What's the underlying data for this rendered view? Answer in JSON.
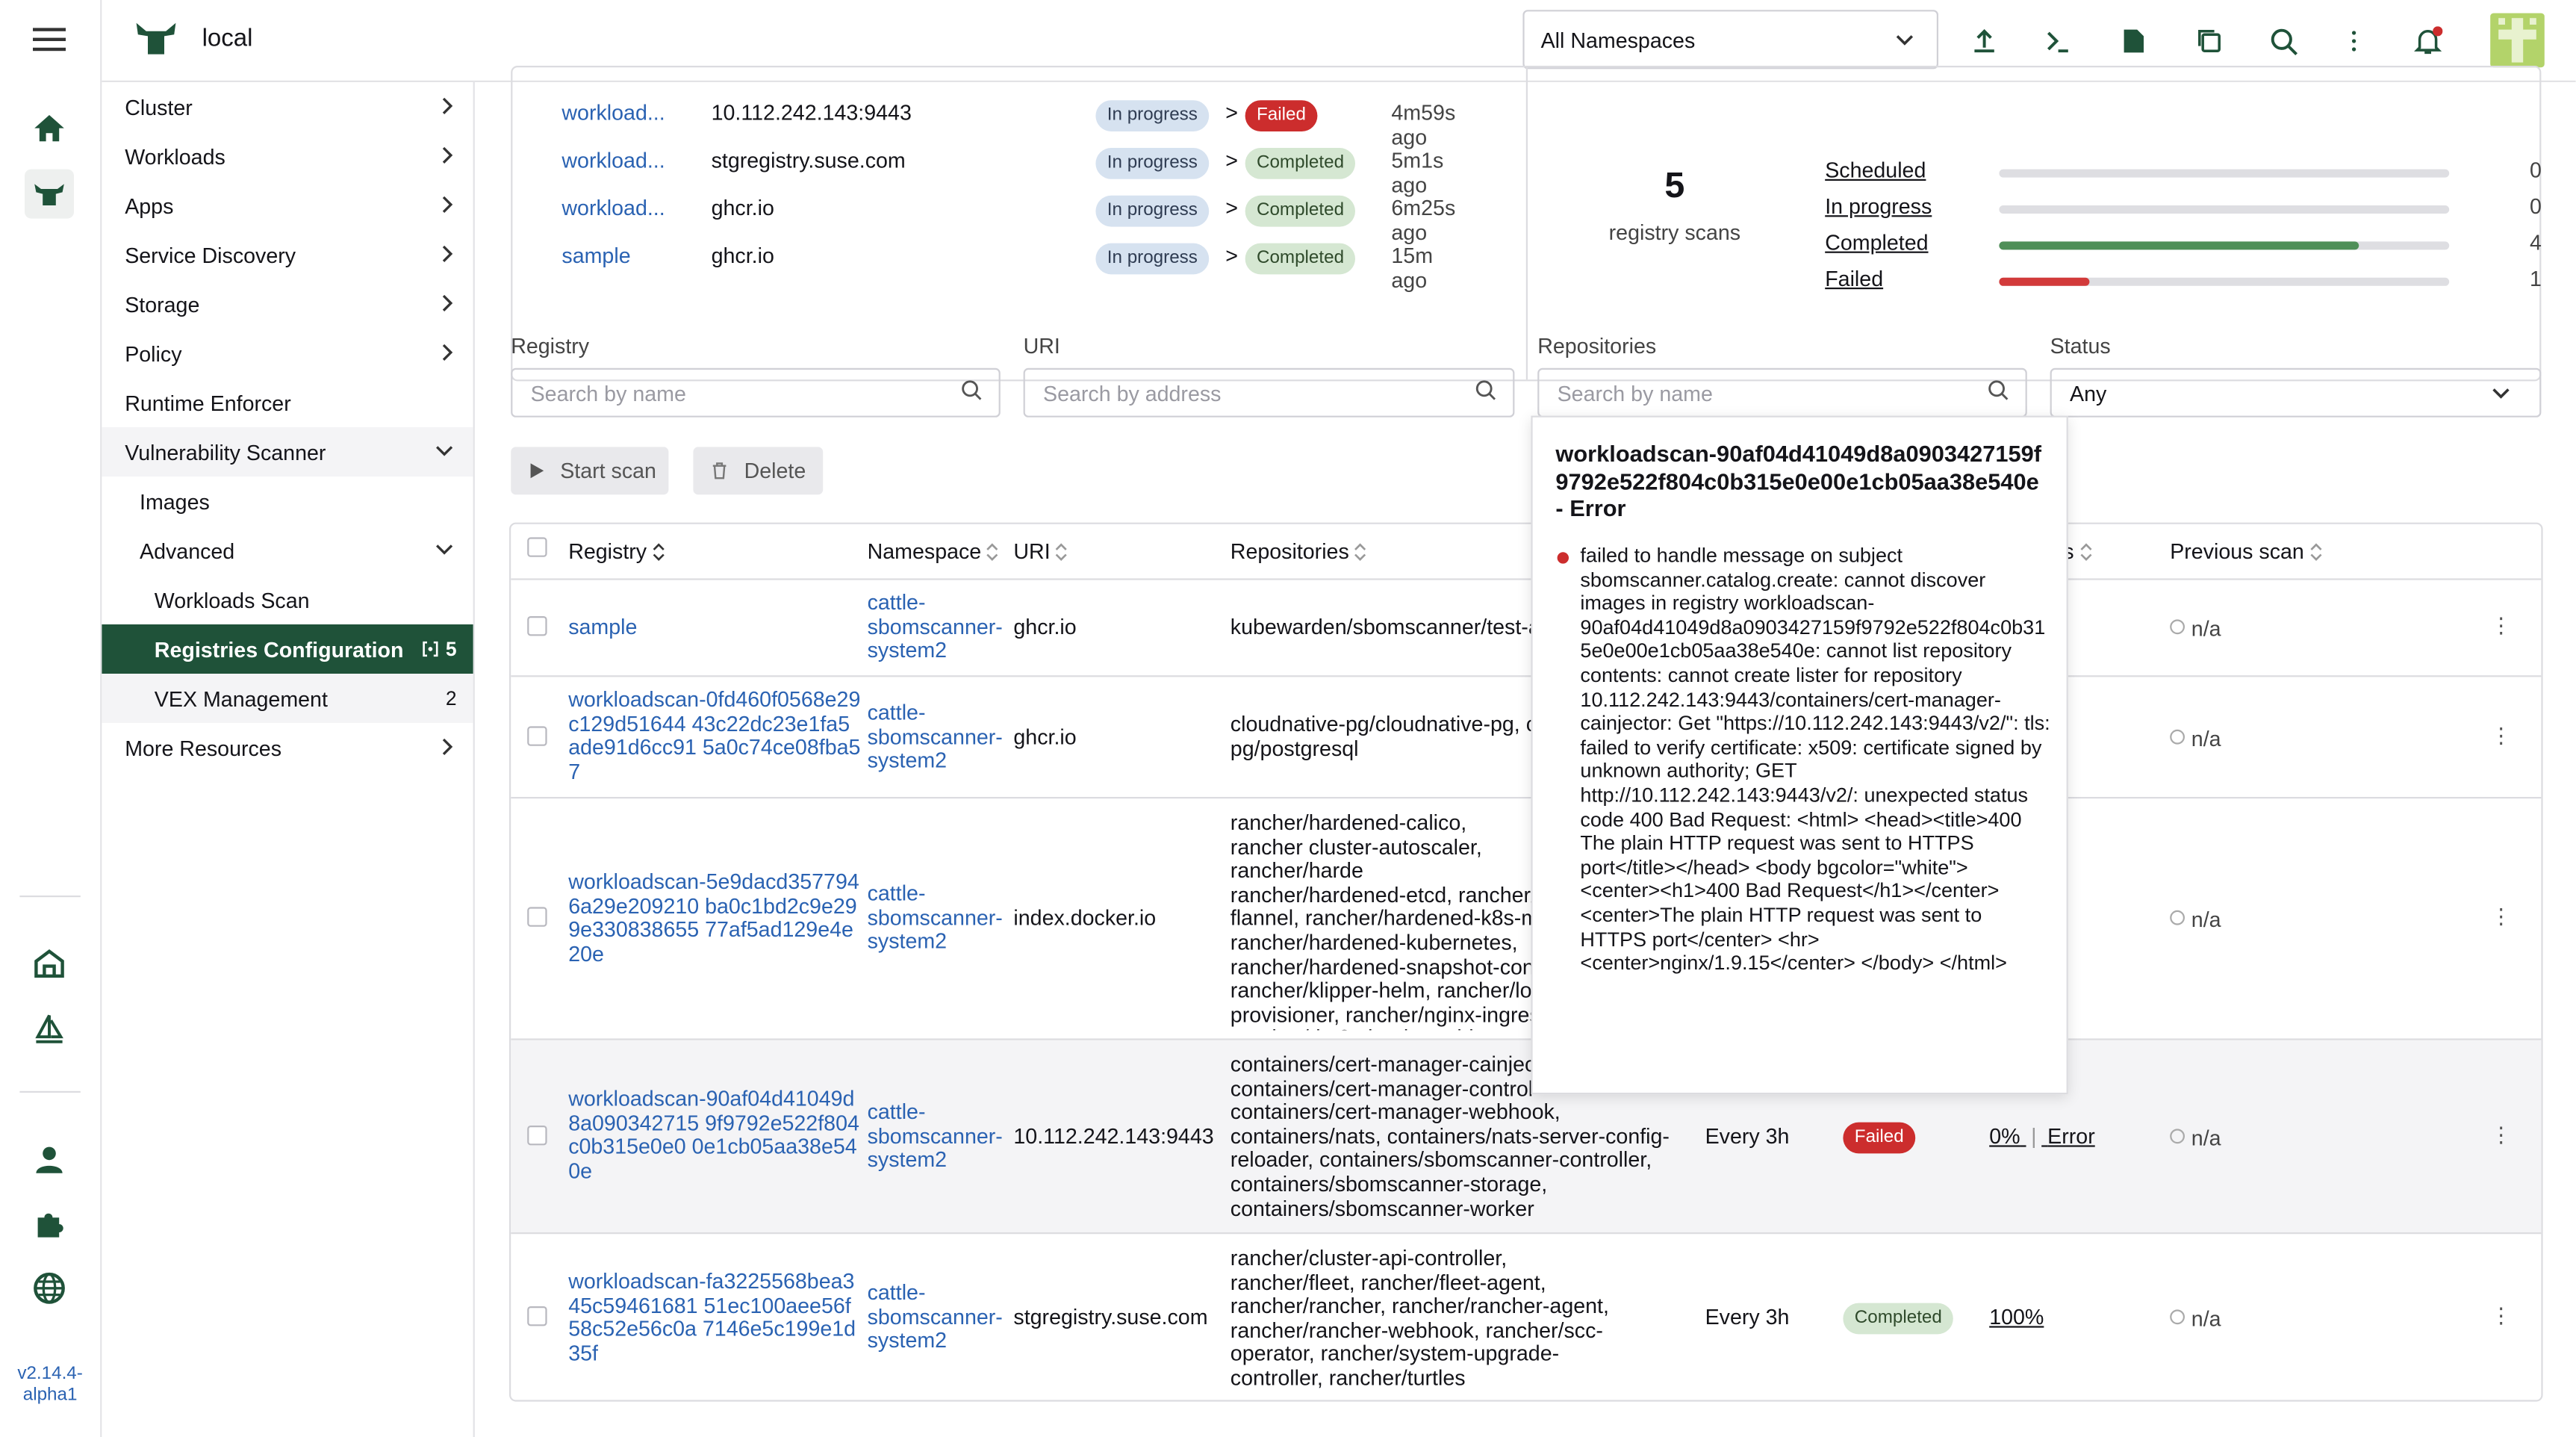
{
  "header": {
    "cluster_name": "local",
    "namespace_select": "All Namespaces"
  },
  "rail": {
    "version": "v2.14.4-alpha1"
  },
  "nav": {
    "items": [
      {
        "label": "Cluster"
      },
      {
        "label": "Workloads"
      },
      {
        "label": "Apps"
      },
      {
        "label": "Service Discovery"
      },
      {
        "label": "Storage"
      },
      {
        "label": "Policy"
      },
      {
        "label": "Runtime Enforcer"
      },
      {
        "label": "Vulnerability Scanner"
      },
      {
        "label": "Images"
      },
      {
        "label": "Advanced"
      },
      {
        "label": "Workloads Scan"
      },
      {
        "label": "Registries Configuration",
        "count": "5"
      },
      {
        "label": "VEX Management",
        "count": "2"
      },
      {
        "label": "More Resources"
      }
    ]
  },
  "recent_scans": [
    {
      "name": "workload...",
      "registry": "10.112.242.143:9443",
      "from": "In progress",
      "to": "Failed",
      "ago": "4m59s ago"
    },
    {
      "name": "workload...",
      "registry": "stgregistry.suse.com",
      "from": "In progress",
      "to": "Completed",
      "ago": "5m1s ago"
    },
    {
      "name": "workload...",
      "registry": "ghcr.io",
      "from": "In progress",
      "to": "Completed",
      "ago": "6m25s ago"
    },
    {
      "name": "sample",
      "registry": "ghcr.io",
      "from": "In progress",
      "to": "Completed",
      "ago": "15m ago"
    }
  ],
  "arrow": ">",
  "summary": {
    "total": "5",
    "total_label": "registry scans",
    "stats": [
      {
        "label": "Scheduled",
        "value": 0,
        "color": "#dedee2"
      },
      {
        "label": "In progress",
        "value": 0,
        "color": "#dedee2"
      },
      {
        "label": "Completed",
        "value": 4,
        "color": "#4f8f58"
      },
      {
        "label": "Failed",
        "value": 1,
        "color": "#d23a3a"
      }
    ],
    "fill_fractions": [
      0,
      0,
      0.8,
      0.2
    ]
  },
  "filters": {
    "registry_label": "Registry",
    "registry_placeholder": "Search by name",
    "uri_label": "URI",
    "uri_placeholder": "Search by address",
    "repos_label": "Repositories",
    "repos_placeholder": "Search by name",
    "status_label": "Status",
    "status_value": "Any"
  },
  "actions": {
    "start_scan": "Start scan",
    "delete": "Delete"
  },
  "table": {
    "headers": {
      "registry": "Registry",
      "namespace": "Namespace",
      "uri": "URI",
      "repositories": "Repositories",
      "hidden_tail": "s",
      "previous_scan": "Previous scan"
    },
    "rows": [
      {
        "registry": "sample",
        "namespace": "cattle-sbomscanner-system2",
        "uri": "ghcr.io",
        "repositories": "kubewarden/sbomscanner/test-a",
        "previous": "n/a"
      },
      {
        "registry": "workloadscan-0fd460f0568e29c129d51644 43c22dc23e1fa5ade91d6cc91 5a0c74ce08fba57",
        "namespace": "cattle-sbomscanner-system2",
        "uri": "ghcr.io",
        "repositories": "cloudnative-pg/cloudnative-pg, c pg/postgresql",
        "previous": "n/a"
      },
      {
        "registry": "workloadscan-5e9dacd3577946a29e209210 ba0c1bd2c9e299e330838655 77af5ad129e4e20e",
        "namespace": "cattle-sbomscanner-system2",
        "uri": "index.docker.io",
        "repositories": "rancher/hardened-calico, rancher cluster-autoscaler, rancher/harde rancher/hardened-etcd, rancher/ flannel, rancher/hardened-k8s-m rancher/hardened-kubernetes, rancher/hardened-snapshot-cont rancher/klipper-helm, rancher/lo provisioner, rancher/nginx-ingres rancher/rke2-cloud-provider",
        "previous": "n/a"
      },
      {
        "registry": "workloadscan-90af04d41049d8a090342715 9f9792e522f804c0b315e0e0 0e1cb05aa38e540e",
        "namespace": "cattle-sbomscanner-system2",
        "uri": "10.112.242.143:9443",
        "repositories": "containers/cert-manager-cainject containers/cert-manager-control containers/cert-manager-webhook, containers/nats, containers/nats-server-config-reloader, containers/sbomscanner-controller, containers/sbomscanner-storage, containers/sbomscanner-worker",
        "schedule": "Every 3h",
        "status": "Failed",
        "progress": "0%",
        "sep": "|",
        "error": "Error",
        "previous": "n/a"
      },
      {
        "registry": "workloadscan-fa3225568bea345c59461681 51ec100aee56f58c52e56c0a 7146e5c199e1d35f",
        "namespace": "cattle-sbomscanner-system2",
        "uri": "stgregistry.suse.com",
        "repositories": "rancher/cluster-api-controller, rancher/fleet, rancher/fleet-agent, rancher/rancher, rancher/rancher-agent, rancher/rancher-webhook, rancher/scc-operator, rancher/system-upgrade-controller, rancher/turtles",
        "schedule": "Every 3h",
        "status": "Completed",
        "progress": "100%",
        "previous": "n/a"
      }
    ],
    "kebab": "⋮"
  },
  "tooltip": {
    "title": "workloadscan-90af04d41049d8a0903427159f9792e522f804c0b315e0e00e1cb05aa38e540e - Error",
    "message": "failed to handle message on subject sbomscanner.catalog.create: cannot discover images in registry workloadscan-90af04d41049d8a0903427159f9792e522f804c0b315e0e00e1cb05aa38e540e: cannot list repository contents: cannot create lister for repository 10.112.242.143:9443/containers/cert-manager-cainjector: Get \"https://10.112.242.143:9443/v2/\": tls: failed to verify certificate: x509: certificate signed by unknown authority; GET http://10.112.242.143:9443/v2/: unexpected status code 400 Bad Request: <html> <head><title>400 The plain HTTP request was sent to HTTPS port</title></head> <body bgcolor=\"white\"> <center><h1>400 Bad Request</h1></center> <center>The plain HTTP request was sent to HTTPS port</center> <hr><center>nginx/1.9.15</center> </body> </html>"
  }
}
